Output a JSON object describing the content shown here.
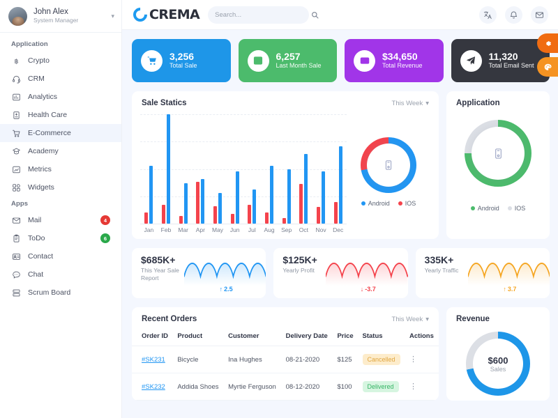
{
  "sidebar": {
    "profile": {
      "name": "John Alex",
      "role": "System Manager",
      "chevron_icon": "chevron-down-icon"
    },
    "sections": [
      {
        "title": "Application",
        "items": [
          {
            "label": "Crypto",
            "icon": "bitcoin-icon",
            "active": false,
            "badge": null
          },
          {
            "label": "CRM",
            "icon": "headset-icon",
            "active": false,
            "badge": null
          },
          {
            "label": "Analytics",
            "icon": "chart-icon",
            "active": false,
            "badge": null
          },
          {
            "label": "Health Care",
            "icon": "hospital-icon",
            "active": false,
            "badge": null
          },
          {
            "label": "E-Commerce",
            "icon": "cart-icon",
            "active": true,
            "badge": null
          },
          {
            "label": "Academy",
            "icon": "graduation-cap-icon",
            "active": false,
            "badge": null
          },
          {
            "label": "Metrics",
            "icon": "metrics-icon",
            "active": false,
            "badge": null
          },
          {
            "label": "Widgets",
            "icon": "widgets-icon",
            "active": false,
            "badge": null
          }
        ]
      },
      {
        "title": "Apps",
        "items": [
          {
            "label": "Mail",
            "icon": "envelope-icon",
            "active": false,
            "badge": "4",
            "badge_color": "red"
          },
          {
            "label": "ToDo",
            "icon": "clipboard-icon",
            "active": false,
            "badge": "6",
            "badge_color": "green"
          },
          {
            "label": "Contact",
            "icon": "contact-card-icon",
            "active": false,
            "badge": null
          },
          {
            "label": "Chat",
            "icon": "chat-bubble-icon",
            "active": false,
            "badge": null
          },
          {
            "label": "Scrum Board",
            "icon": "board-icon",
            "active": false,
            "badge": null
          }
        ]
      }
    ]
  },
  "topbar": {
    "logo_text": "CREMA",
    "logo_icon": "crema-c-logo",
    "search": {
      "placeholder": "Search...",
      "value": "",
      "icon": "search-icon"
    },
    "actions": [
      {
        "name": "translate-button",
        "icon": "translate-icon",
        "glyph": "文"
      },
      {
        "name": "notifications-button",
        "icon": "bell-icon",
        "glyph": ""
      },
      {
        "name": "messages-button",
        "icon": "envelope-icon",
        "glyph": ""
      }
    ]
  },
  "stats": [
    {
      "value": "3,256",
      "caption": "Total Sale",
      "color": "#1e96e8",
      "icon": "shopping-cart-icon"
    },
    {
      "value": "6,257",
      "caption": "Last Month Sale",
      "color": "#4cbb6c",
      "icon": "growth-chart-icon"
    },
    {
      "value": "$34,650",
      "caption": "Total Revenue",
      "color": "#a135e8",
      "icon": "wallet-icon"
    },
    {
      "value": "11,320",
      "caption": "Total Email Sent",
      "color": "#35373f",
      "icon": "paper-plane-icon"
    }
  ],
  "sale_statics": {
    "title": "Sale Statics",
    "filter": "This Week",
    "legend": [
      {
        "label": "Android",
        "color": "#2196f3"
      },
      {
        "label": "IOS",
        "color": "#f4434c"
      }
    ],
    "donut": {
      "android_pct": 72,
      "ios_pct": 28,
      "center_icon": "mobile-phone-icon"
    }
  },
  "application_card": {
    "title": "Application",
    "legend": [
      {
        "label": "Android",
        "color": "#4cbb6c"
      },
      {
        "label": "IOS",
        "color": "#dcdfe5"
      }
    ],
    "donut": {
      "android_pct": 75,
      "ios_pct": 25,
      "center_icon": "mobile-phone-icon"
    }
  },
  "sparklines": [
    {
      "value": "$685K+",
      "caption": "This Year Sale Report",
      "color": "#2196f3",
      "trend": "2.5",
      "trend_dir": "up",
      "trend_icon": "arrow-up-icon"
    },
    {
      "value": "$125K+",
      "caption": "Yearly Profit",
      "color": "#f4434c",
      "trend": "-3.7",
      "trend_dir": "down",
      "trend_icon": "arrow-down-icon"
    },
    {
      "value": "335K+",
      "caption": "Yearly Traffic",
      "color": "#f5a623",
      "trend": "3.7",
      "trend_dir": "up",
      "trend_icon": "arrow-up-icon"
    }
  ],
  "recent_orders": {
    "title": "Recent Orders",
    "filter": "This Week",
    "columns": [
      "Order ID",
      "Product",
      "Customer",
      "Delivery Date",
      "Price",
      "Status",
      "Actions"
    ],
    "rows": [
      {
        "order_id": "#SK231",
        "product": "Bicycle",
        "customer": "Ina Hughes",
        "delivery_date": "08-21-2020",
        "price": "$125",
        "status": "Cancelled",
        "status_class": "cancelled"
      },
      {
        "order_id": "#SK232",
        "product": "Addida Shoes",
        "customer": "Myrtie Ferguson",
        "delivery_date": "08-12-2020",
        "price": "$100",
        "status": "Delivered",
        "status_class": "delivered"
      }
    ]
  },
  "revenue_card": {
    "title": "Revenue",
    "center_value": "$600",
    "center_caption": "Sales",
    "donut": {
      "filled_pct": 72,
      "color": "#1e96e8",
      "track": "#dcdfe5"
    }
  },
  "floating": [
    {
      "name": "settings-fab",
      "icon": "gear-icon"
    },
    {
      "name": "theme-fab",
      "icon": "palette-icon"
    }
  ],
  "chart_data": {
    "type": "bar",
    "title": "Sale Statics",
    "categories": [
      "Jan",
      "Feb",
      "Mar",
      "Apr",
      "May",
      "Jun",
      "Jul",
      "Aug",
      "Sep",
      "Oct",
      "Nov",
      "Dec"
    ],
    "series": [
      {
        "name": "Android",
        "color": "#2196f3",
        "values": [
          53,
          100,
          37,
          41,
          28,
          48,
          31,
          53,
          50,
          64,
          48,
          71
        ]
      },
      {
        "name": "IOS",
        "color": "#f4434c",
        "values": [
          10,
          17,
          7,
          38,
          16,
          9,
          17,
          10,
          5,
          36,
          15,
          20
        ]
      }
    ],
    "ylim": [
      0,
      100
    ],
    "xlabel": "",
    "ylabel": "",
    "grid": true,
    "legend_position": "right"
  }
}
